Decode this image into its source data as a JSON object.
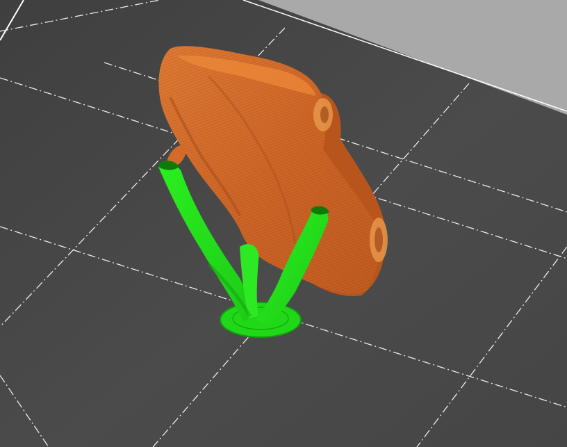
{
  "viewport": {
    "background_color": "#a9a9a9",
    "bed_color": "#454545",
    "bed_edge_color": "#2e2e2e",
    "grid_line_color": "#ffffff",
    "model_color": "#d46a28",
    "model_shadow_color": "#a9501d",
    "model_highlight_color": "#f08a3a",
    "support_color": "#22e01a",
    "support_shadow_color": "#159a10",
    "support_highlight_color": "#6bff4f",
    "scene_objects": [
      {
        "name": "print-bed",
        "kind": "bed"
      },
      {
        "name": "printed-model",
        "kind": "model"
      },
      {
        "name": "tree-supports",
        "kind": "support"
      }
    ]
  }
}
